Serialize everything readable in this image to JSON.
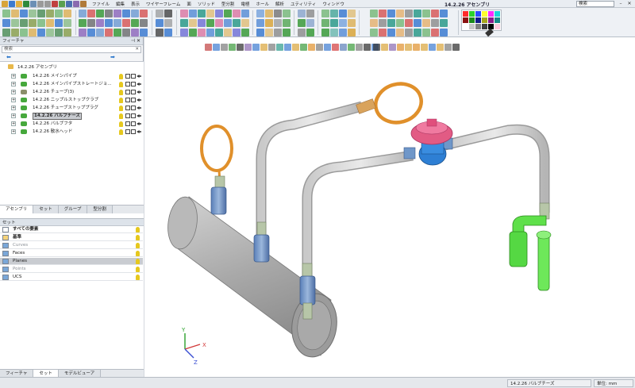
{
  "menubar": {
    "items": [
      "ファイル",
      "編集",
      "表示",
      "ワイヤーフレーム",
      "面",
      "ソリッド",
      "型分割",
      "電極",
      "ホール",
      "解析",
      "ユティリティ",
      "ウィンドウ"
    ],
    "app_title": "14.2.26 アセンブリ",
    "search_placeholder": "検索"
  },
  "palette_colors": [
    "#ff2b2b",
    "#2bd22b",
    "#2b4bff",
    "#ffff2b",
    "#ff2bff",
    "#1ad6d6",
    "#8a1212",
    "#1a8a1a",
    "#121a8a",
    "#a6a61a",
    "#8a1a8a",
    "#1a8a8a",
    "#ffffff",
    "#c8c8c8",
    "#808080",
    "#404040",
    "#000000",
    "#ffc8dc"
  ],
  "panel": {
    "title": "フィーチャ",
    "search_label": "検索",
    "nav_back": "⬅",
    "nav_forward": "➡",
    "root_label": "14.2.26 アセンブリ",
    "items": [
      {
        "label": "14.2.26 メインパイプ",
        "icon": "part-icon",
        "selected": false
      },
      {
        "label": "14.2.26 メインパイプストレートジョ...",
        "icon": "part-icon",
        "selected": false
      },
      {
        "label": "14.2.26 チューブ(3)",
        "icon": "assembly-icon",
        "selected": false
      },
      {
        "label": "14.2.26 ニップルストップクラブ",
        "icon": "part-icon",
        "selected": false
      },
      {
        "label": "14.2.26 チューブストッププラグ",
        "icon": "part-icon",
        "selected": false
      },
      {
        "label": "14.2.26 バルブチーズ",
        "icon": "part-icon",
        "selected": true
      },
      {
        "label": "14.2.26 バルブフタ",
        "icon": "part-icon",
        "selected": false
      },
      {
        "label": "14.2.26 散水ヘッド",
        "icon": "part-icon",
        "selected": false
      }
    ],
    "tabs_top": [
      "アセンブリ",
      "セット",
      "グループ",
      "型分割"
    ],
    "sets_title": "セット",
    "sets": [
      {
        "label": "すべての要素",
        "style": "bold"
      },
      {
        "label": "基準",
        "style": "bold"
      },
      {
        "label": "Curves",
        "style": "grey"
      },
      {
        "label": "Faces",
        "style": "normal"
      },
      {
        "label": "Planes",
        "style": "selected"
      },
      {
        "label": "Points",
        "style": "grey"
      },
      {
        "label": "UCS",
        "style": "normal"
      }
    ],
    "tabs_bottom": [
      "フィーチャ",
      "セット",
      "モデルビューア"
    ]
  },
  "axes": {
    "x": "X",
    "y": "Y",
    "z": "Z"
  },
  "statusbar": {
    "selection": "14.2.26 バルブチーズ",
    "units": "単位: mm"
  }
}
